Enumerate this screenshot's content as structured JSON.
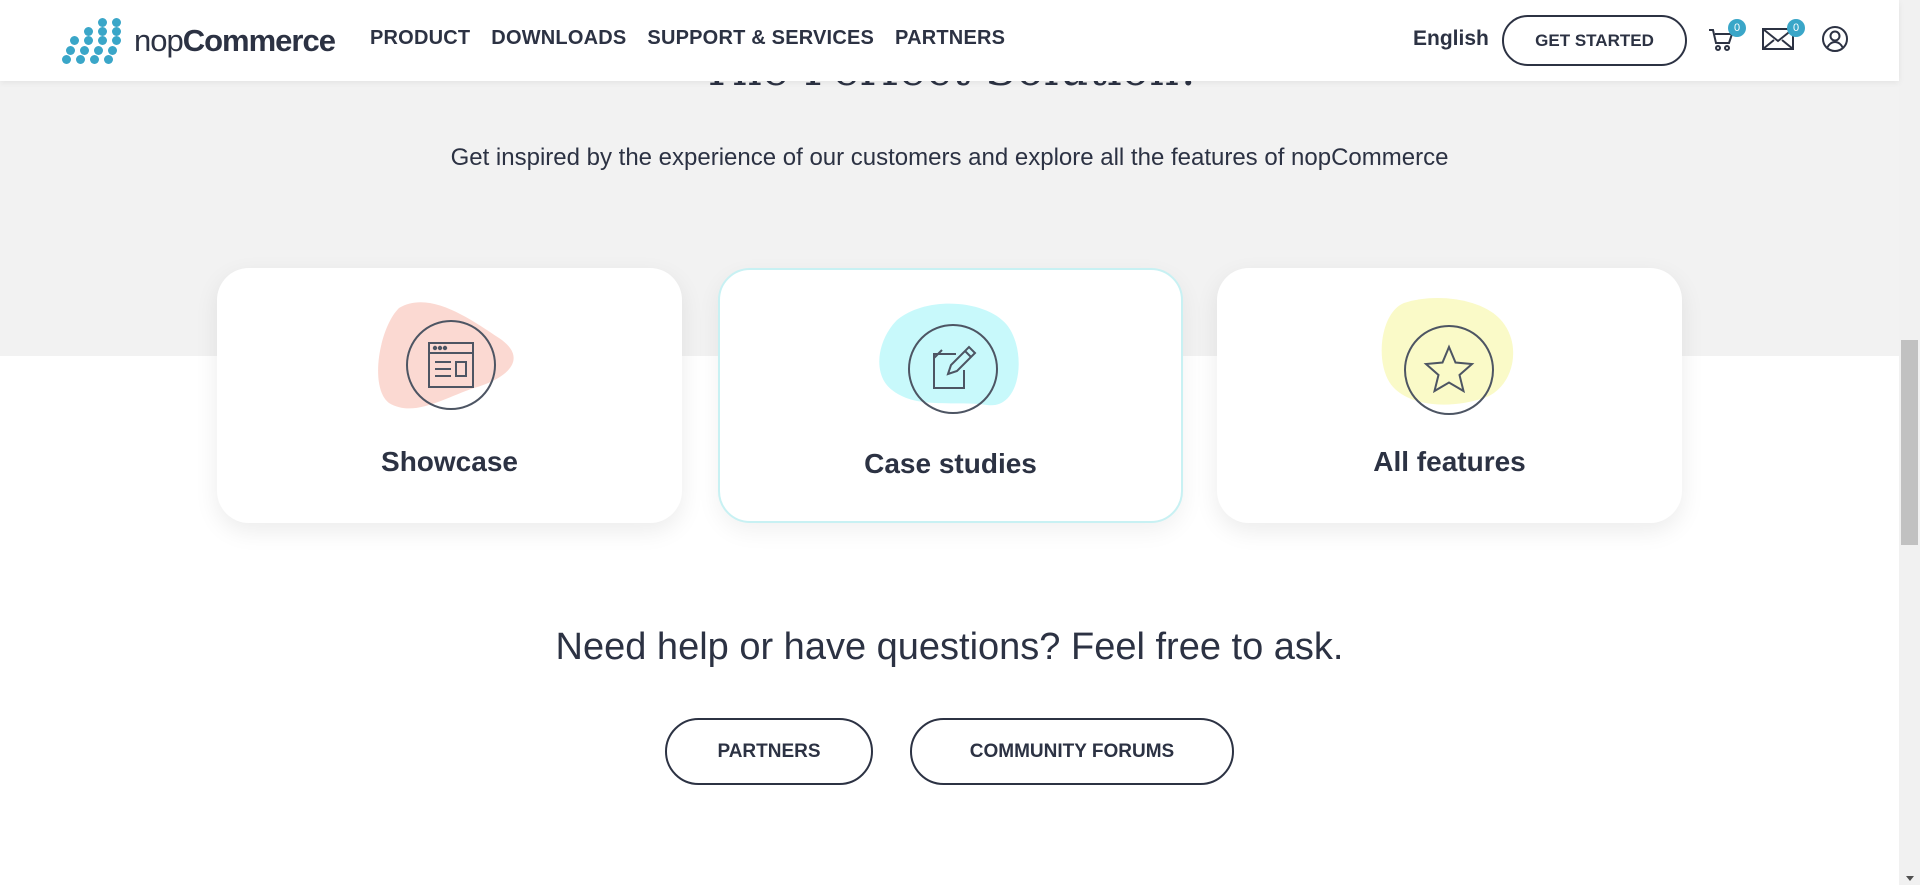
{
  "brand": {
    "prefix": "nop",
    "name": "Commerce",
    "accent": "#3aa6c8"
  },
  "nav": [
    {
      "label": "PRODUCT"
    },
    {
      "label": "DOWNLOADS"
    },
    {
      "label": "SUPPORT & SERVICES"
    },
    {
      "label": "PARTNERS"
    }
  ],
  "header": {
    "language": "English",
    "get_started": "GET STARTED",
    "cart_icon": "cart-icon",
    "cart_count": "0",
    "mail_icon": "mail-icon",
    "mail_count": "0",
    "account_icon": "user-circle-icon"
  },
  "hero": {
    "title_partial": "The Perfect Solution!",
    "subtitle": "Get inspired by the experience of our customers and explore all the features of nopCommerce"
  },
  "cards": [
    {
      "label": "Showcase",
      "icon": "browser-window-icon",
      "blob_color": "#fbd9d2"
    },
    {
      "label": "Case studies",
      "icon": "edit-note-icon",
      "blob_color": "#c8f9fb"
    },
    {
      "label": "All features",
      "icon": "star-icon",
      "blob_color": "#fafac8"
    }
  ],
  "help": {
    "text": "Need help or have questions? Feel free to ask.",
    "partners_button": "PARTNERS",
    "forums_button": "COMMUNITY FORUMS"
  }
}
